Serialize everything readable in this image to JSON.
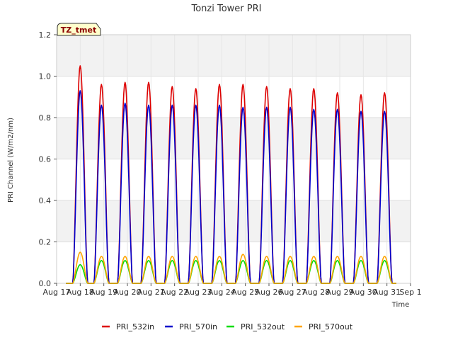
{
  "chart_data": {
    "type": "line",
    "title": "Tonzi Tower PRI",
    "xlabel": "Time",
    "ylabel": "PRI Channel (W/m2/nm)",
    "annotation": "TZ_tmet",
    "grid": true,
    "legend_position": "bottom",
    "xlim": [
      17,
      32
    ],
    "ylim": [
      0,
      1.2
    ],
    "x_ticks": [
      {
        "value": 17,
        "label": "Aug 17"
      },
      {
        "value": 18,
        "label": "Aug 18"
      },
      {
        "value": 19,
        "label": "Aug 19"
      },
      {
        "value": 20,
        "label": "Aug 20"
      },
      {
        "value": 21,
        "label": "Aug 21"
      },
      {
        "value": 22,
        "label": "Aug 22"
      },
      {
        "value": 23,
        "label": "Aug 23"
      },
      {
        "value": 24,
        "label": "Aug 24"
      },
      {
        "value": 25,
        "label": "Aug 25"
      },
      {
        "value": 26,
        "label": "Aug 26"
      },
      {
        "value": 27,
        "label": "Aug 27"
      },
      {
        "value": 28,
        "label": "Aug 28"
      },
      {
        "value": 29,
        "label": "Aug 29"
      },
      {
        "value": 30,
        "label": "Aug 30"
      },
      {
        "value": 31,
        "label": "Aug 31"
      },
      {
        "value": 32,
        "label": "Sep 1"
      }
    ],
    "y_ticks": [
      {
        "value": 0.0,
        "label": "0.0"
      },
      {
        "value": 0.2,
        "label": "0.2"
      },
      {
        "value": 0.4,
        "label": "0.4"
      },
      {
        "value": 0.6,
        "label": "0.6"
      },
      {
        "value": 0.8,
        "label": "0.8"
      },
      {
        "value": 1.0,
        "label": "1.0"
      },
      {
        "value": 1.2,
        "label": "1.2"
      }
    ],
    "daily_peak_time": [
      18.0,
      18.9,
      19.9,
      20.9,
      21.9,
      22.9,
      23.9,
      24.9,
      25.9,
      26.9,
      27.9,
      28.9,
      29.9,
      30.9
    ],
    "series": [
      {
        "name": "PRI_532in",
        "color": "#dd0000",
        "daily_peaks": [
          1.05,
          0.96,
          0.97,
          0.97,
          0.95,
          0.94,
          0.96,
          0.96,
          0.95,
          0.94,
          0.94,
          0.92,
          0.91,
          0.92
        ]
      },
      {
        "name": "PRI_570in",
        "color": "#0000cc",
        "daily_peaks": [
          0.93,
          0.86,
          0.87,
          0.86,
          0.86,
          0.86,
          0.86,
          0.85,
          0.85,
          0.85,
          0.84,
          0.84,
          0.83,
          0.83
        ]
      },
      {
        "name": "PRI_532out",
        "color": "#00dd00",
        "daily_peaks": [
          0.09,
          0.11,
          0.11,
          0.11,
          0.11,
          0.11,
          0.11,
          0.11,
          0.11,
          0.11,
          0.11,
          0.11,
          0.11,
          0.11
        ]
      },
      {
        "name": "PRI_570out",
        "color": "#ffa500",
        "daily_peaks": [
          0.15,
          0.13,
          0.13,
          0.13,
          0.13,
          0.13,
          0.13,
          0.14,
          0.13,
          0.13,
          0.13,
          0.13,
          0.13,
          0.13
        ]
      }
    ]
  }
}
